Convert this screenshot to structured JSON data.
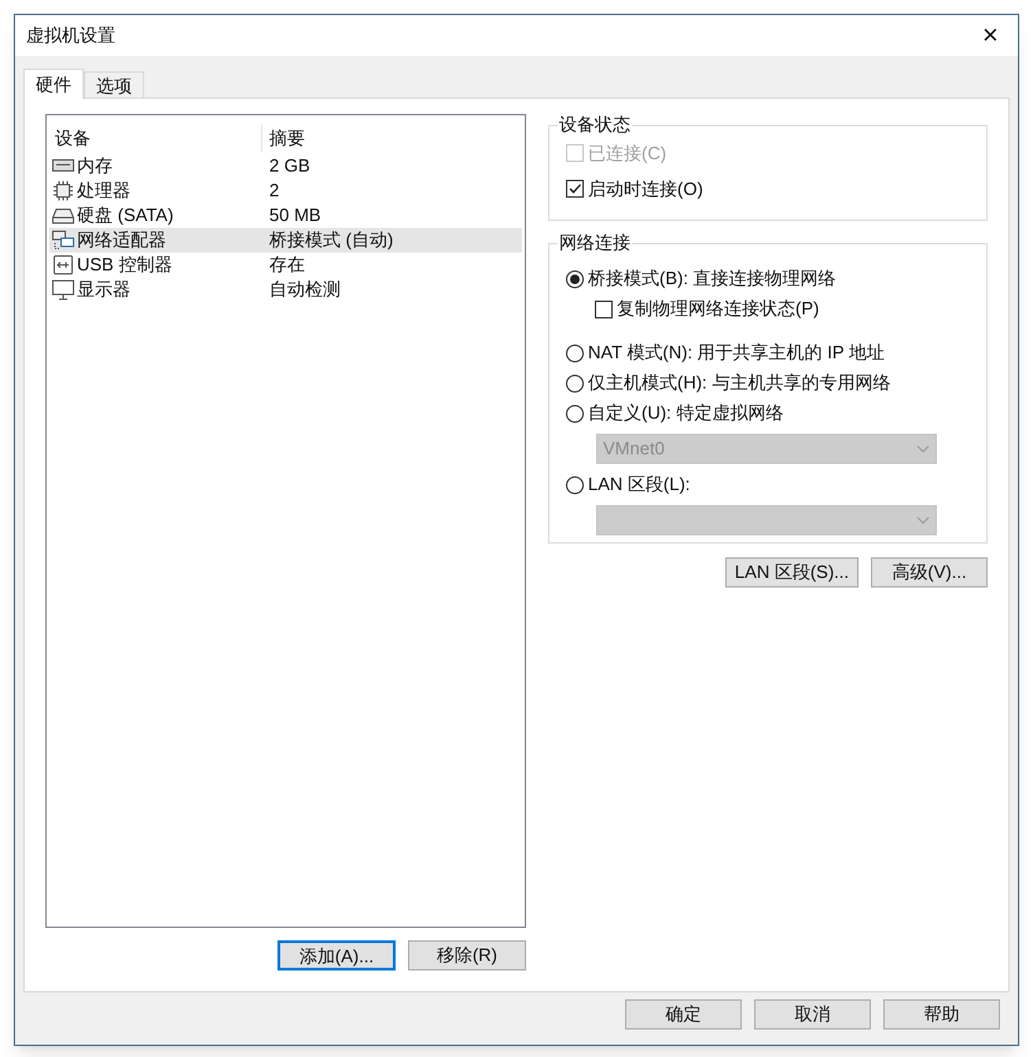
{
  "window": {
    "title": "虚拟机设置",
    "close": "×"
  },
  "tabs": [
    {
      "label": "硬件",
      "selected": true
    },
    {
      "label": "选项",
      "selected": false
    }
  ],
  "devices": {
    "columns": [
      "设备",
      "摘要"
    ],
    "rows": [
      {
        "kind": "memory",
        "device": "内存",
        "summary": "2 GB",
        "selected": false
      },
      {
        "kind": "cpu",
        "device": "处理器",
        "summary": "2",
        "selected": false
      },
      {
        "kind": "disk",
        "device": "硬盘 (SATA)",
        "summary": "50 MB",
        "selected": false
      },
      {
        "kind": "network",
        "device": "网络适配器",
        "summary": "桥接模式 (自动)",
        "selected": true
      },
      {
        "kind": "usb",
        "device": "USB 控制器",
        "summary": "存在",
        "selected": false
      },
      {
        "kind": "display",
        "device": "显示器",
        "summary": "自动检测",
        "selected": false
      }
    ],
    "buttons": [
      {
        "label": "添加(A)...",
        "focused": true
      },
      {
        "label": "移除(R)",
        "focused": false
      }
    ]
  },
  "device_status": {
    "title": "设备状态",
    "items": [
      {
        "label": "已连接(C)",
        "checked": false,
        "disabled": true
      },
      {
        "label": "启动时连接(O)",
        "checked": true,
        "disabled": false
      }
    ]
  },
  "network_connection": {
    "title": "网络连接",
    "items": [
      {
        "kind": "radio",
        "label": "桥接模式(B): 直接连接物理网络",
        "selected": true
      },
      {
        "kind": "checkbox",
        "label": "复制物理网络连接状态(P)",
        "checked": false
      },
      {
        "kind": "radio",
        "label": "NAT 模式(N): 用于共享主机的 IP 地址",
        "selected": false
      },
      {
        "kind": "radio",
        "label": "仅主机模式(H): 与主机共享的专用网络",
        "selected": false
      },
      {
        "kind": "radio",
        "label": "自定义(U): 特定虚拟网络",
        "selected": false
      },
      {
        "kind": "dropdown",
        "value": "VMnet0",
        "disabled": true
      },
      {
        "kind": "radio",
        "label": "LAN 区段(L):",
        "selected": false
      },
      {
        "kind": "dropdown",
        "value": "",
        "disabled": true
      }
    ]
  },
  "network_buttons": [
    "LAN 区段(S)...",
    "高级(V)..."
  ],
  "footer_buttons": [
    "确定",
    "取消",
    "帮助"
  ]
}
